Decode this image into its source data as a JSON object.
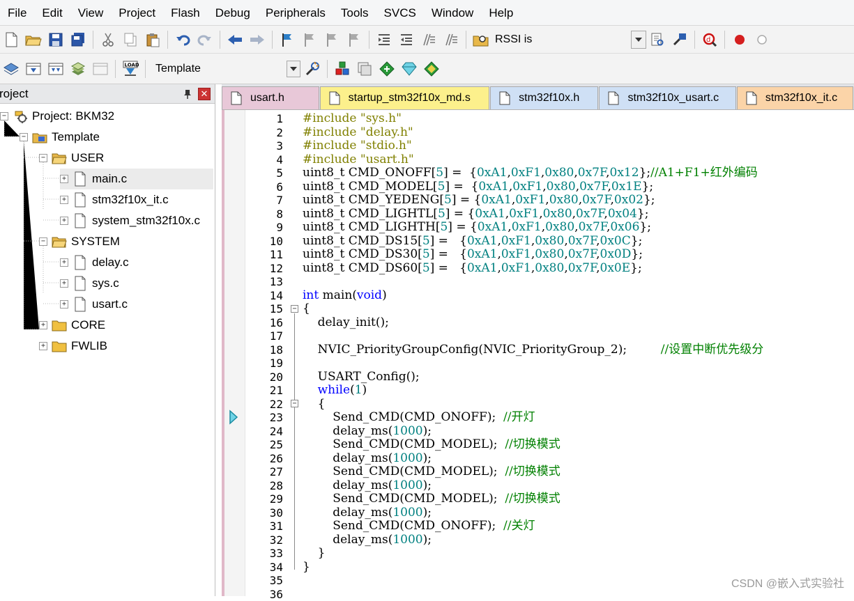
{
  "menubar": {
    "items": [
      "File",
      "Edit",
      "View",
      "Project",
      "Flash",
      "Debug",
      "Peripherals",
      "Tools",
      "SVCS",
      "Window",
      "Help"
    ]
  },
  "toolbar1": {
    "search_text": "RSSI is"
  },
  "toolbar2": {
    "target": "Template"
  },
  "project": {
    "title": "roject",
    "pin_icon": "pin-icon",
    "close_icon": "close-icon",
    "root": "Project: BKM32",
    "target": "Template",
    "groups": [
      "USER",
      "SYSTEM",
      "CORE",
      "FWLIB"
    ],
    "files": {
      "user": [
        "main.c",
        "stm32f10x_it.c",
        "system_stm32f10x.c"
      ],
      "system": [
        "delay.c",
        "sys.c",
        "usart.c"
      ]
    }
  },
  "tabs": [
    {
      "label": "usart.h",
      "color": "#e8c8d8"
    },
    {
      "label": "startup_stm32f10x_md.s",
      "color": "#fcf08c"
    },
    {
      "label": "stm32f10x.h",
      "color": "#cfe0f5"
    },
    {
      "label": "stm32f10x_usart.c",
      "color": "#cfe0f5"
    },
    {
      "label": "stm32f10x_it.c",
      "color": "#fbd4a8"
    }
  ],
  "editor": {
    "line_numbers": [
      "1",
      "2",
      "3",
      "4",
      "5",
      "6",
      "7",
      "8",
      "9",
      "10",
      "11",
      "12",
      "13",
      "14",
      "15",
      "16",
      "17",
      "18",
      "19",
      "20",
      "21",
      "22",
      "23",
      "24",
      "25",
      "26",
      "27",
      "28",
      "29",
      "30",
      "31",
      "32",
      "33",
      "34",
      "35",
      "36"
    ],
    "lines": [
      [
        [
          "pre",
          "#include "
        ],
        [
          "str",
          "\"sys.h\""
        ]
      ],
      [
        [
          "pre",
          "#include "
        ],
        [
          "str",
          "\"delay.h\""
        ]
      ],
      [
        [
          "pre",
          "#include "
        ],
        [
          "str",
          "\"stdio.h\""
        ]
      ],
      [
        [
          "pre",
          "#include "
        ],
        [
          "str",
          "\"usart.h\""
        ]
      ],
      [
        [
          "txt",
          "uint8_t CMD_ONOFF["
        ],
        [
          "num",
          "5"
        ],
        [
          "txt",
          "] =  {"
        ],
        [
          "num",
          "0xA1"
        ],
        [
          "txt",
          ","
        ],
        [
          "num",
          "0xF1"
        ],
        [
          "txt",
          ","
        ],
        [
          "num",
          "0x80"
        ],
        [
          "txt",
          ","
        ],
        [
          "num",
          "0x7F"
        ],
        [
          "txt",
          ","
        ],
        [
          "num",
          "0x12"
        ],
        [
          "txt",
          "};"
        ],
        [
          "com",
          "//A1+F1+红外编码"
        ]
      ],
      [
        [
          "txt",
          "uint8_t CMD_MODEL["
        ],
        [
          "num",
          "5"
        ],
        [
          "txt",
          "] =  {"
        ],
        [
          "num",
          "0xA1"
        ],
        [
          "txt",
          ","
        ],
        [
          "num",
          "0xF1"
        ],
        [
          "txt",
          ","
        ],
        [
          "num",
          "0x80"
        ],
        [
          "txt",
          ","
        ],
        [
          "num",
          "0x7F"
        ],
        [
          "txt",
          ","
        ],
        [
          "num",
          "0x1E"
        ],
        [
          "txt",
          "};"
        ]
      ],
      [
        [
          "txt",
          "uint8_t CMD_YEDENG["
        ],
        [
          "num",
          "5"
        ],
        [
          "txt",
          "] = {"
        ],
        [
          "num",
          "0xA1"
        ],
        [
          "txt",
          ","
        ],
        [
          "num",
          "0xF1"
        ],
        [
          "txt",
          ","
        ],
        [
          "num",
          "0x80"
        ],
        [
          "txt",
          ","
        ],
        [
          "num",
          "0x7F"
        ],
        [
          "txt",
          ","
        ],
        [
          "num",
          "0x02"
        ],
        [
          "txt",
          "};"
        ]
      ],
      [
        [
          "txt",
          "uint8_t CMD_LIGHTL["
        ],
        [
          "num",
          "5"
        ],
        [
          "txt",
          "] = {"
        ],
        [
          "num",
          "0xA1"
        ],
        [
          "txt",
          ","
        ],
        [
          "num",
          "0xF1"
        ],
        [
          "txt",
          ","
        ],
        [
          "num",
          "0x80"
        ],
        [
          "txt",
          ","
        ],
        [
          "num",
          "0x7F"
        ],
        [
          "txt",
          ","
        ],
        [
          "num",
          "0x04"
        ],
        [
          "txt",
          "};"
        ]
      ],
      [
        [
          "txt",
          "uint8_t CMD_LIGHTH["
        ],
        [
          "num",
          "5"
        ],
        [
          "txt",
          "] = {"
        ],
        [
          "num",
          "0xA1"
        ],
        [
          "txt",
          ","
        ],
        [
          "num",
          "0xF1"
        ],
        [
          "txt",
          ","
        ],
        [
          "num",
          "0x80"
        ],
        [
          "txt",
          ","
        ],
        [
          "num",
          "0x7F"
        ],
        [
          "txt",
          ","
        ],
        [
          "num",
          "0x06"
        ],
        [
          "txt",
          "};"
        ]
      ],
      [
        [
          "txt",
          "uint8_t CMD_DS15["
        ],
        [
          "num",
          "5"
        ],
        [
          "txt",
          "] =   {"
        ],
        [
          "num",
          "0xA1"
        ],
        [
          "txt",
          ","
        ],
        [
          "num",
          "0xF1"
        ],
        [
          "txt",
          ","
        ],
        [
          "num",
          "0x80"
        ],
        [
          "txt",
          ","
        ],
        [
          "num",
          "0x7F"
        ],
        [
          "txt",
          ","
        ],
        [
          "num",
          "0x0C"
        ],
        [
          "txt",
          "};"
        ]
      ],
      [
        [
          "txt",
          "uint8_t CMD_DS30["
        ],
        [
          "num",
          "5"
        ],
        [
          "txt",
          "] =   {"
        ],
        [
          "num",
          "0xA1"
        ],
        [
          "txt",
          ","
        ],
        [
          "num",
          "0xF1"
        ],
        [
          "txt",
          ","
        ],
        [
          "num",
          "0x80"
        ],
        [
          "txt",
          ","
        ],
        [
          "num",
          "0x7F"
        ],
        [
          "txt",
          ","
        ],
        [
          "num",
          "0x0D"
        ],
        [
          "txt",
          "};"
        ]
      ],
      [
        [
          "txt",
          "uint8_t CMD_DS60["
        ],
        [
          "num",
          "5"
        ],
        [
          "txt",
          "] =   {"
        ],
        [
          "num",
          "0xA1"
        ],
        [
          "txt",
          ","
        ],
        [
          "num",
          "0xF1"
        ],
        [
          "txt",
          ","
        ],
        [
          "num",
          "0x80"
        ],
        [
          "txt",
          ","
        ],
        [
          "num",
          "0x7F"
        ],
        [
          "txt",
          ","
        ],
        [
          "num",
          "0x0E"
        ],
        [
          "txt",
          "};"
        ]
      ],
      [],
      [
        [
          "kw",
          "int"
        ],
        [
          "txt",
          " main("
        ],
        [
          "kw",
          "void"
        ],
        [
          "txt",
          ")"
        ]
      ],
      [
        [
          "txt",
          "{"
        ]
      ],
      [
        [
          "txt",
          "    delay_init();"
        ]
      ],
      [],
      [
        [
          "txt",
          "    NVIC_PriorityGroupConfig(NVIC_PriorityGroup_2);         "
        ],
        [
          "com",
          "//设置中断优先级分"
        ]
      ],
      [],
      [
        [
          "txt",
          "    USART_Config();"
        ]
      ],
      [
        [
          "txt",
          "    "
        ],
        [
          "kw",
          "while"
        ],
        [
          "txt",
          "("
        ],
        [
          "num",
          "1"
        ],
        [
          "txt",
          ")"
        ]
      ],
      [
        [
          "txt",
          "    {"
        ]
      ],
      [
        [
          "txt",
          "        Send_CMD(CMD_ONOFF);  "
        ],
        [
          "com",
          "//开灯"
        ]
      ],
      [
        [
          "txt",
          "        delay_ms("
        ],
        [
          "num",
          "1000"
        ],
        [
          "txt",
          ");"
        ]
      ],
      [
        [
          "txt",
          "        Send_CMD(CMD_MODEL);  "
        ],
        [
          "com",
          "//切换模式"
        ]
      ],
      [
        [
          "txt",
          "        delay_ms("
        ],
        [
          "num",
          "1000"
        ],
        [
          "txt",
          ");"
        ]
      ],
      [
        [
          "txt",
          "        Send_CMD(CMD_MODEL);  "
        ],
        [
          "com",
          "//切换模式"
        ]
      ],
      [
        [
          "txt",
          "        delay_ms("
        ],
        [
          "num",
          "1000"
        ],
        [
          "txt",
          ");"
        ]
      ],
      [
        [
          "txt",
          "        Send_CMD(CMD_MODEL);  "
        ],
        [
          "com",
          "//切换模式"
        ]
      ],
      [
        [
          "txt",
          "        delay_ms("
        ],
        [
          "num",
          "1000"
        ],
        [
          "txt",
          ");"
        ]
      ],
      [
        [
          "txt",
          "        Send_CMD(CMD_ONOFF);  "
        ],
        [
          "com",
          "//关灯"
        ]
      ],
      [
        [
          "txt",
          "        delay_ms("
        ],
        [
          "num",
          "1000"
        ],
        [
          "txt",
          ");"
        ]
      ],
      [
        [
          "txt",
          "    }"
        ]
      ],
      [
        [
          "txt",
          "}"
        ]
      ],
      [],
      []
    ]
  },
  "watermark": "CSDN @嵌入式实验社"
}
